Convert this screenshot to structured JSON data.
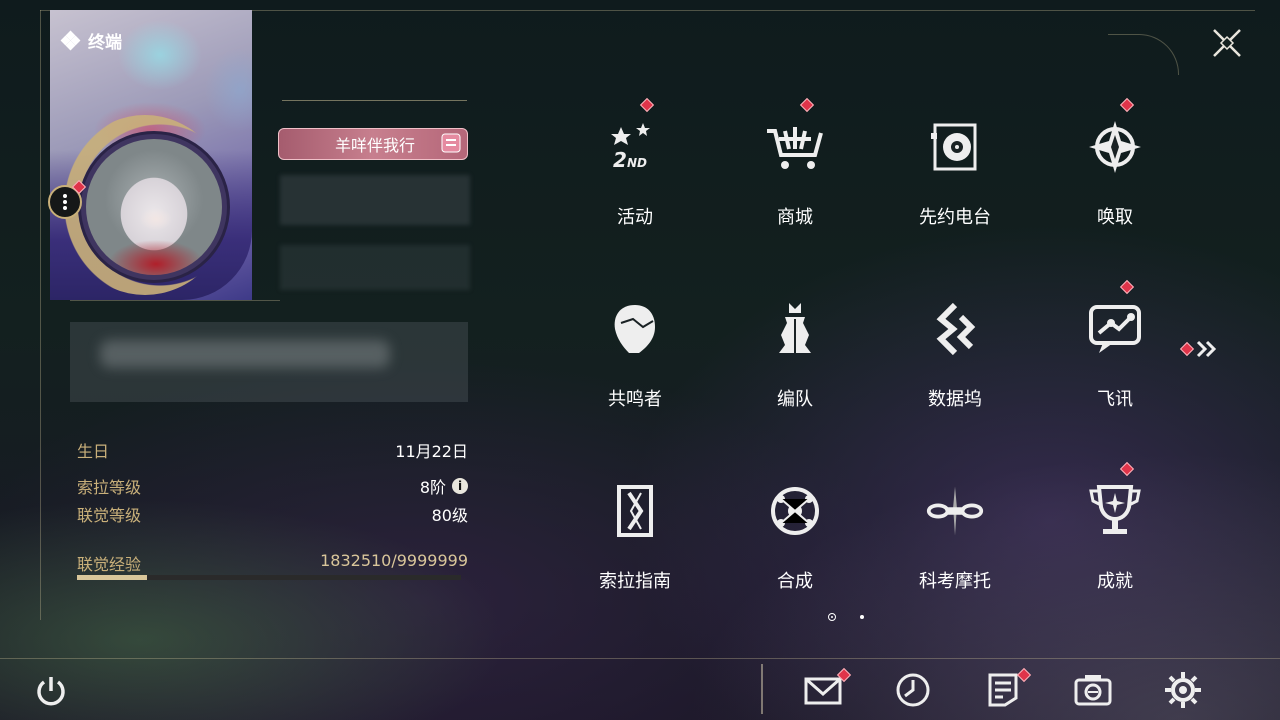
{
  "header": {
    "section_title": "终端"
  },
  "profile": {
    "player_name": "羊咩伴我行"
  },
  "stats": {
    "birthday_label": "生日",
    "birthday_value": "11月22日",
    "sola_level_label": "索拉等级",
    "sola_level_value": "8阶",
    "union_level_label": "联觉等级",
    "union_level_value": "80级",
    "union_exp_label": "联觉经验",
    "union_exp_value": "1832510/9999999",
    "union_exp_progress": 0.1833
  },
  "menu": {
    "items": [
      {
        "label": "活动",
        "icon": "event-icon",
        "badge": true
      },
      {
        "label": "商城",
        "icon": "shop-cart-icon",
        "badge": true
      },
      {
        "label": "先约电台",
        "icon": "radio-icon",
        "badge": false
      },
      {
        "label": "唤取",
        "icon": "convene-icon",
        "badge": true
      },
      {
        "label": "共鸣者",
        "icon": "resonator-icon",
        "badge": false
      },
      {
        "label": "编队",
        "icon": "team-icon",
        "badge": false
      },
      {
        "label": "数据坞",
        "icon": "data-bank-icon",
        "badge": false
      },
      {
        "label": "飞讯",
        "icon": "message-icon",
        "badge": true
      },
      {
        "label": "索拉指南",
        "icon": "guidebook-icon",
        "badge": false
      },
      {
        "label": "合成",
        "icon": "synthesis-icon",
        "badge": false
      },
      {
        "label": "科考摩托",
        "icon": "motorcycle-icon",
        "badge": false
      },
      {
        "label": "成就",
        "icon": "trophy-icon",
        "badge": true
      }
    ]
  },
  "pager": {
    "pages": 2,
    "current": 1
  },
  "bottom_bar": [
    {
      "icon": "mail-icon",
      "badge": true
    },
    {
      "icon": "clock-icon",
      "badge": false
    },
    {
      "icon": "notice-icon",
      "badge": true
    },
    {
      "icon": "camera-icon",
      "badge": false
    },
    {
      "icon": "settings-gear-icon",
      "badge": false
    }
  ],
  "colors": {
    "accent_gold": "#c9b07a",
    "badge_red": "#e0344a",
    "name_badge_pink": "#c77f8e"
  }
}
